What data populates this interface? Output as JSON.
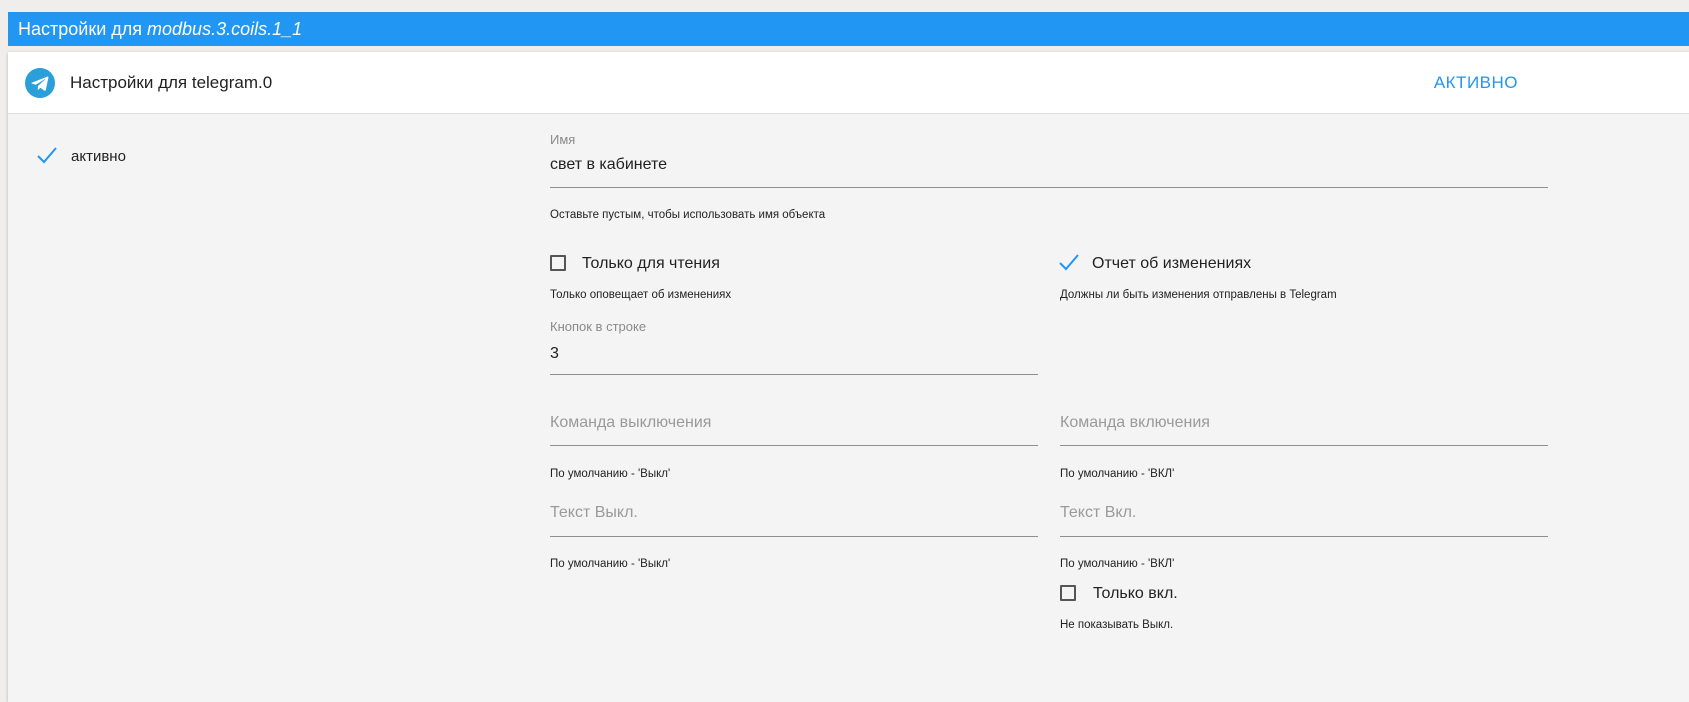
{
  "window": {
    "title_prefix": "Настройки для",
    "object_id": "modbus.3.coils.1_1"
  },
  "adapter": {
    "title": "Настройки для telegram.0",
    "status": "АКТИВНО",
    "icon": "telegram-icon"
  },
  "enabled": {
    "label": "активно",
    "checked": true
  },
  "form": {
    "name": {
      "label": "Имя",
      "value": "свет в кабинете",
      "helper": "Оставьте пустым, чтобы использовать имя объекта"
    },
    "read_only": {
      "label": "Только для чтения",
      "checked": false,
      "helper": "Только оповещает об изменениях"
    },
    "report_changes": {
      "label": "Отчет об изменениях",
      "checked": true,
      "helper": "Должны ли быть изменения отправлены в Telegram"
    },
    "buttons_per_row": {
      "label": "Кнопок в строке",
      "value": "3"
    },
    "off_command": {
      "placeholder": "Команда выключения",
      "helper": "По умолчанию - 'Выкл'"
    },
    "on_command": {
      "placeholder": "Команда включения",
      "helper": "По умолчанию - 'ВКЛ'"
    },
    "off_text": {
      "placeholder": "Текст Выкл.",
      "helper": "По умолчанию - 'Выкл'"
    },
    "on_text": {
      "placeholder": "Текст Вкл.",
      "helper": "По умолчанию - 'ВКЛ'"
    },
    "only_on": {
      "label": "Только вкл.",
      "checked": false,
      "helper": "Не показывать Выкл."
    }
  },
  "colors": {
    "accent": "#2196f3",
    "title_bar": "#2196f3",
    "panel_bg": "#f4f4f4"
  }
}
